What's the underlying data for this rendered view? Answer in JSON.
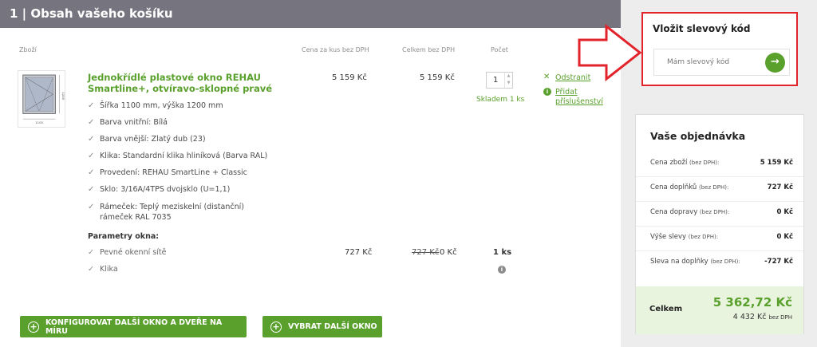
{
  "header": {
    "title": "1 | Obsah vašeho košíku"
  },
  "columns": {
    "item": "Zboží",
    "unit_price": "Cena za kus bez DPH",
    "total_price": "Celkem bez DPH",
    "quantity": "Počet"
  },
  "product": {
    "name": "Jednokřídlé plastové okno REHAU Smartline+, otvíravo-sklopné pravé",
    "unit_price": "5 159 Kč",
    "total_price": "5 159 Kč",
    "quantity": "1",
    "stock": "Skladem 1 ks",
    "actions": {
      "remove": "Odstranit",
      "add_accessories": "Přidat příslušenství"
    },
    "attributes": [
      "Šířka 1100 mm, výška 1200 mm",
      "Barva vnitřní: Bílá",
      "Barva vnější: Zlatý dub (23)",
      "Klika: Standardní klika hliníková (Barva RAL)",
      "Provedení: REHAU SmartLine + Classic",
      "Sklo: 3/16A/4TPS dvojsklo (U=1,1)",
      "Rámeček: Teplý meziskelní (distanční) rámeček RAL 7035"
    ],
    "thumbnail_labels": {
      "width": "1100",
      "height": "1200"
    }
  },
  "parameters": {
    "title": "Parametry okna:",
    "items": [
      {
        "label": "Pevné okenní sítě",
        "unit_price": "727 Kč",
        "old_price": "727 Kč",
        "total_price": "0 Kč",
        "quantity": "1 ks"
      },
      {
        "label": "Klika",
        "info": "i"
      }
    ]
  },
  "buttons": {
    "configure": "KONFIGUROVAT DALŠÍ OKNO A DVEŘE NA MÍRU",
    "choose": "VYBRAT DALŠÍ OKNO"
  },
  "discount": {
    "title": "Vložit slevový kód",
    "placeholder": "Mám slevový kód",
    "submit_icon": "arrow-right-icon"
  },
  "order": {
    "title": "Vaše objednávka",
    "rows": [
      {
        "label": "Cena zboží",
        "note": "(bez DPH):",
        "value": "5 159 Kč"
      },
      {
        "label": "Cena doplňků",
        "note": "(bez DPH):",
        "value": "727 Kč"
      },
      {
        "label": "Cena dopravy",
        "note": "(bez DPH):",
        "value": "0 Kč"
      },
      {
        "label": "Výše slevy",
        "note": "(bez DPH):",
        "value": "0 Kč"
      },
      {
        "label": "Sleva na doplňky",
        "note": "(bez DPH):",
        "value": "-727 Kč"
      }
    ],
    "total_label": "Celkem",
    "total_value": "5 362,72 Kč",
    "total_without_vat": "4 432 Kč",
    "total_without_vat_note": "bez DPH"
  },
  "colors": {
    "accent_green": "#5aa02c",
    "header_gray": "#76757f",
    "highlight_red": "#e3232b",
    "total_bg": "#e9f4df"
  }
}
